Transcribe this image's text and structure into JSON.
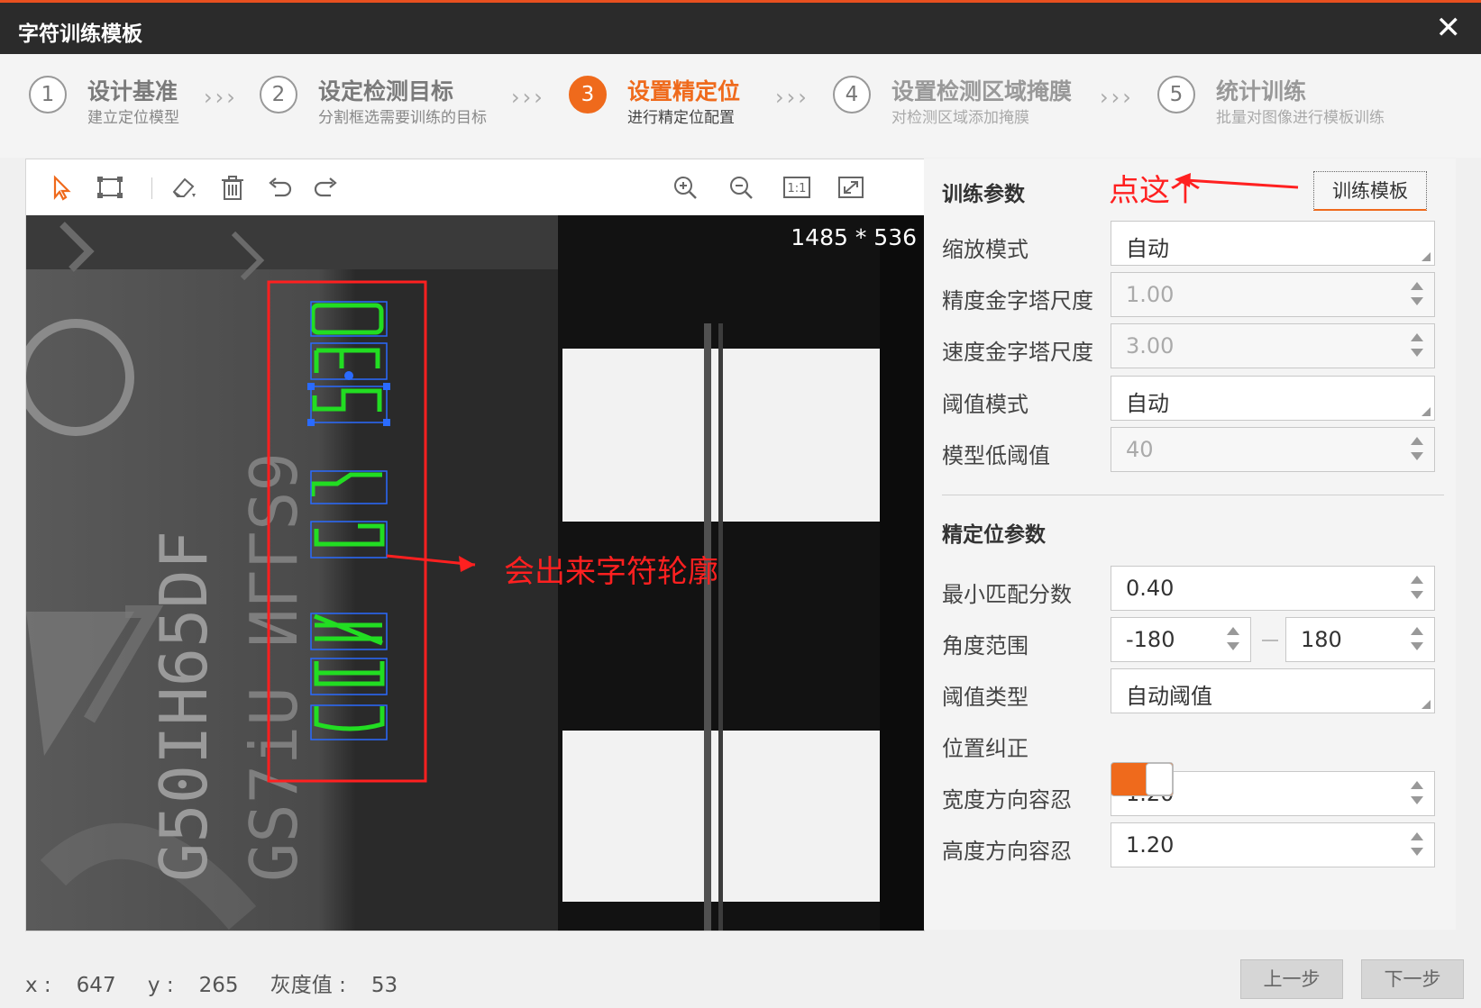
{
  "window": {
    "title": "字符训练模板",
    "close_glyph": "✕"
  },
  "steps": [
    {
      "num": "1",
      "title": "设计基准",
      "sub": "建立定位模型"
    },
    {
      "num": "2",
      "title": "设定检测目标",
      "sub": "分割框选需要训练的目标"
    },
    {
      "num": "3",
      "title": "设置精定位",
      "sub": "进行精定位配置"
    },
    {
      "num": "4",
      "title": "设置检测区域掩膜",
      "sub": "对检测区域添加掩膜"
    },
    {
      "num": "5",
      "title": "统计训练",
      "sub": "批量对图像进行模板训练"
    }
  ],
  "steps_separator": "›››",
  "viewer": {
    "dimensions": "1485 * 536",
    "tools": [
      "select-icon",
      "rect-icon",
      "eraser-icon",
      "trash-icon",
      "undo-icon",
      "redo-icon",
      "zoom-in-icon",
      "zoom-out-icon",
      "one-to-one-icon",
      "fit-icon"
    ],
    "one_to_one": "1:1",
    "image_text": {
      "line1": "G50IH65DF",
      "line2": "GS7iU ИГГS9",
      "chars": [
        "0",
        "3",
        "5",
        "5",
        "G",
        "N",
        "H",
        "C"
      ]
    }
  },
  "status": {
    "x_label": "x :",
    "x": "647",
    "y_label": "y :",
    "y": "265",
    "gray_label": "灰度值 :",
    "gray": "53"
  },
  "panel": {
    "train_section": "训练参数",
    "train_button": "训练模板",
    "fields": [
      {
        "label": "缩放模式",
        "value": "自动",
        "type": "select"
      },
      {
        "label": "精度金字塔尺度",
        "value": "1.00",
        "type": "spin-disabled"
      },
      {
        "label": "速度金字塔尺度",
        "value": "3.00",
        "type": "spin-disabled"
      },
      {
        "label": "阈值模式",
        "value": "自动",
        "type": "select"
      },
      {
        "label": "模型低阈值",
        "value": "40",
        "type": "spin-disabled"
      }
    ],
    "locate_section": "精定位参数",
    "min_score": {
      "label": "最小匹配分数",
      "value": "0.40"
    },
    "angle": {
      "label": "角度范围",
      "min": "-180",
      "max": "180"
    },
    "threshold_type": {
      "label": "阈值类型",
      "value": "自动阈值"
    },
    "position_correct": {
      "label": "位置纠正",
      "on": true
    },
    "width_tol": {
      "label": "宽度方向容忍",
      "value": "1.20"
    },
    "height_tol": {
      "label": "高度方向容忍",
      "value": "1.20"
    }
  },
  "annotations": {
    "click_here": "点这个",
    "outline_note": "会出来字符轮廓"
  },
  "footer": {
    "prev": "上一步",
    "next": "下一步"
  },
  "colors": {
    "accent": "#ef6a1c",
    "annotation": "#ff2020",
    "outline": "#22dd22",
    "box": "#2a6bff"
  }
}
